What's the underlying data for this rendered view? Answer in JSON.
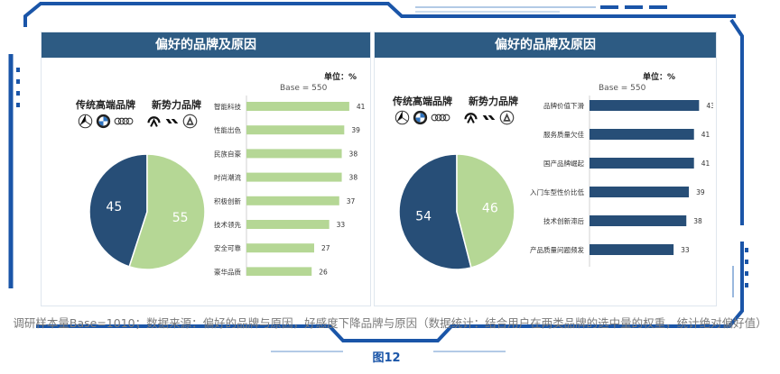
{
  "colors": {
    "frame_blue": "#1a55a8",
    "title_bar": "#2d5b83",
    "green": "#b5d795",
    "navy": "#274e77",
    "grid": "#d9d9d9"
  },
  "left_panel": {
    "title": "偏好的品牌及原因",
    "unit": "单位：%",
    "base": "Base = 550",
    "legacy_label": "传统高端品牌",
    "new_label": "新势力品牌",
    "legacy_logos": [
      "mercedes-logo-icon",
      "bmw-logo-icon",
      "audi-logo-icon"
    ],
    "new_logos": [
      "nio-logo-icon",
      "li-auto-logo-icon",
      "aito-logo-icon"
    ]
  },
  "right_panel": {
    "title": "偏好的品牌及原因",
    "unit": "单位：%",
    "base": "Base = 550",
    "legacy_label": "传统高端品牌",
    "new_label": "新势力品牌",
    "legacy_logos": [
      "mercedes-logo-icon",
      "bmw-logo-icon",
      "audi-logo-icon"
    ],
    "new_logos": [
      "nio-logo-icon",
      "li-auto-logo-icon",
      "aito-logo-icon"
    ]
  },
  "chart_data": [
    {
      "type": "pie",
      "labels": [
        "传统高端品牌",
        "新势力品牌"
      ],
      "values": [
        45,
        55
      ],
      "colors": [
        "#274e77",
        "#b5d795"
      ]
    },
    {
      "type": "bar",
      "orientation": "horizontal",
      "categories": [
        "智能科技",
        "性能出色",
        "民族自豪",
        "时尚潮流",
        "积极创新",
        "技术领先",
        "安全可靠",
        "豪华品质"
      ],
      "values": [
        41,
        39,
        38,
        38,
        37,
        33,
        27,
        26
      ],
      "xlim": [
        0,
        45
      ],
      "color": "#b5d795",
      "grid": false
    },
    {
      "type": "pie",
      "labels": [
        "传统高端品牌",
        "新势力品牌"
      ],
      "values": [
        54,
        46
      ],
      "colors": [
        "#274e77",
        "#b5d795"
      ]
    },
    {
      "type": "bar",
      "orientation": "horizontal",
      "categories": [
        "品牌价值下滑",
        "服务质量欠佳",
        "国产品牌崛起",
        "入门车型性价比低",
        "技术创新滞后",
        "产品质量问题频发"
      ],
      "values": [
        43,
        41,
        41,
        39,
        38,
        33
      ],
      "xlim": [
        0,
        45
      ],
      "color": "#274e77",
      "grid": false
    }
  ],
  "caption": "调研样本量Base=1010；数据来源：偏好的品牌与原因，好感度下降品牌与原因（数据统计：结合用户在两类品牌的选中量的权重，统计绝对偏好值）",
  "figure_label": "图12"
}
